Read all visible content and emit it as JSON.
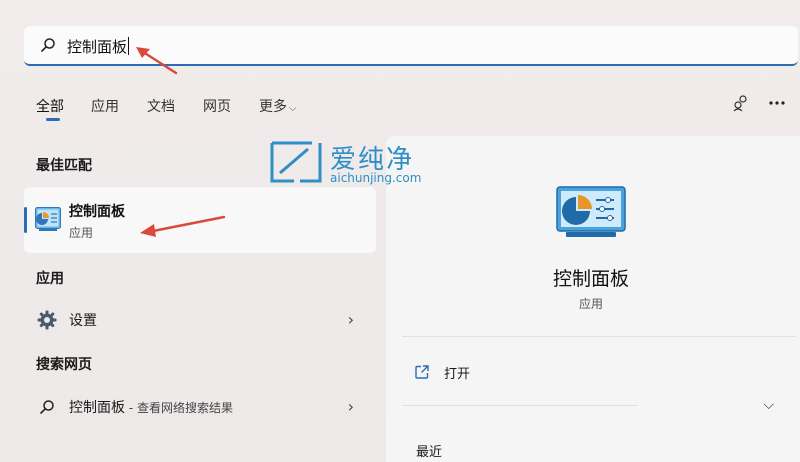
{
  "search": {
    "query": "控制面板"
  },
  "tabs": [
    {
      "label": "全部"
    },
    {
      "label": "应用"
    },
    {
      "label": "文档"
    },
    {
      "label": "网页"
    },
    {
      "label": "更多"
    }
  ],
  "best_match": {
    "section_title": "最佳匹配",
    "name": "控制面板",
    "type": "应用"
  },
  "apps": {
    "section_title": "应用",
    "items": [
      {
        "label": "设置"
      }
    ]
  },
  "web": {
    "section_title": "搜索网页",
    "items": [
      {
        "label": "控制面板",
        "suffix": " - 查看网络搜索结果"
      }
    ]
  },
  "detail": {
    "name": "控制面板",
    "type": "应用",
    "open_label": "打开",
    "recent_label": "最近"
  },
  "watermark": {
    "cn": "爱纯净",
    "en": "aichunjing.com"
  },
  "colors": {
    "accent": "#2b6cb5",
    "watermark": "#2e8fc8",
    "arrow": "#d94a3d"
  }
}
